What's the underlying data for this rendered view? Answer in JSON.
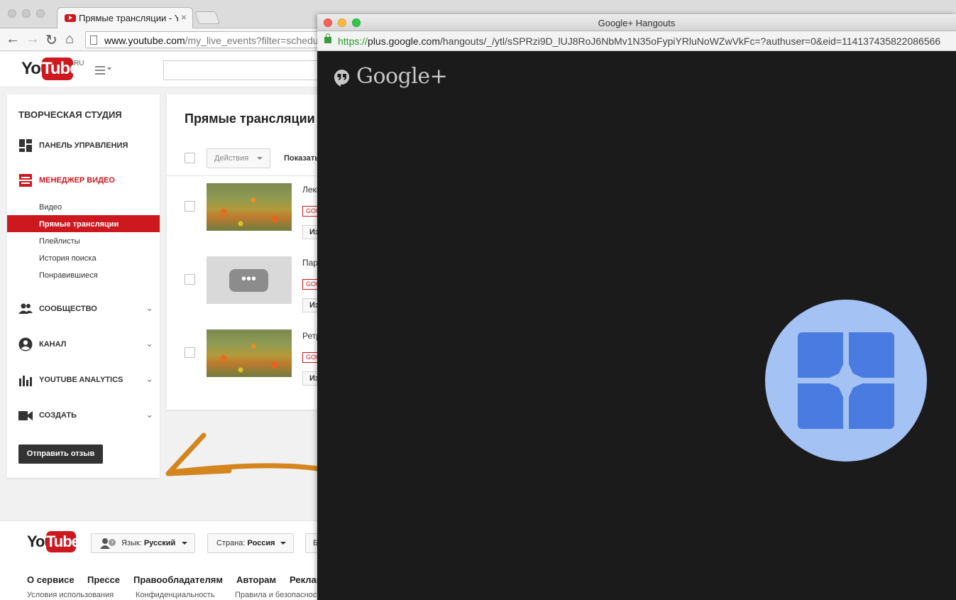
{
  "chrome": {
    "tab_title": "Прямые трансляции - YouTube",
    "tab_close": "×",
    "url_host": "www.youtube.com",
    "url_path": "/my_live_events?filter=scheduled",
    "back_icon": "←",
    "forward_icon": "→",
    "reload_icon": "↻",
    "home_icon": "⌂"
  },
  "youtube": {
    "logo_you": "You",
    "logo_tube": "Tube",
    "region": "RU",
    "sidebar": {
      "studio_title": "ТВОРЧЕСКАЯ СТУДИЯ",
      "dashboard": "ПАНЕЛЬ УПРАВЛЕНИЯ",
      "video_manager": "МЕНЕДЖЕР ВИДЕО",
      "sub_items": [
        "Видео",
        "Прямые трансляции",
        "Плейлисты",
        "История поиска",
        "Понравившиеся"
      ],
      "community": "СООБЩЕСТВО",
      "channel": "КАНАЛ",
      "analytics": "YOUTUBE ANALYTICS",
      "create": "СОЗДАТЬ",
      "chevron": "⌄",
      "feedback": "Отправить отзыв"
    },
    "content": {
      "title": "Прямые трансляции",
      "actions": "Действия",
      "show": "Показать",
      "videos": [
        {
          "title": "Лекция",
          "badge": "GOOGLE",
          "edit": "Изменить"
        },
        {
          "title": "Пара",
          "badge": "GOOGLE",
          "edit": "Изменить",
          "processing": "•••"
        },
        {
          "title": "Ретро",
          "badge": "GOOGLE",
          "edit": "Изменить"
        }
      ]
    },
    "footer": {
      "language_label": "Язык:",
      "language_value": "Русский",
      "country_label": "Страна:",
      "country_value": "Россия",
      "safety_stub": "Б",
      "links": [
        "О сервисе",
        "Прессе",
        "Правообладателям",
        "Авторам",
        "Реклама"
      ],
      "links2": [
        "Условия использования",
        "Конфиденциальность",
        "Правила и безопасность"
      ]
    }
  },
  "hangouts": {
    "window_title": "Google+ Hangouts",
    "url_https": "https://",
    "url_host": "plus.google.com",
    "url_path": "/hangouts/_/ytl/sSPRzi9D_lUJ8RoJ6NbMv1N35oFypiYRluNoWZwVkFc=?authuser=0&eid=114137435822086566",
    "brand": "Google+"
  },
  "colors": {
    "youtube_red": "#cc181e",
    "arrow": "#d4851e",
    "hangout_bg": "#1b1b1b",
    "extension_circle": "#a4c2f4",
    "extension_tile": "#4a7be0"
  }
}
